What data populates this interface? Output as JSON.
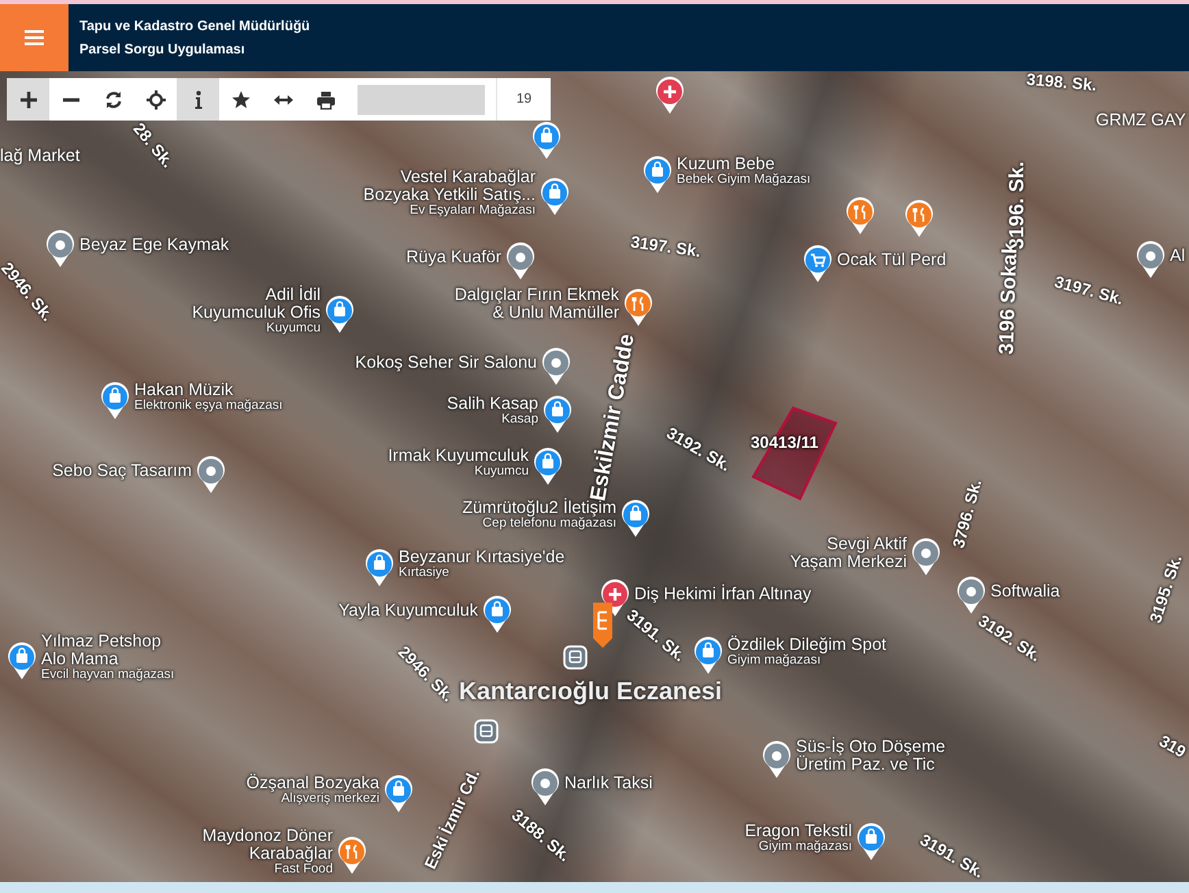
{
  "header": {
    "title": "Tapu ve Kadastro Genel Müdürlüğü",
    "subtitle": "Parsel Sorgu Uygulaması"
  },
  "toolbar": {
    "buttons": [
      {
        "kind": "zoom-in",
        "active": true
      },
      {
        "kind": "zoom-out",
        "active": false
      },
      {
        "kind": "refresh",
        "active": false
      },
      {
        "kind": "locate",
        "active": false
      },
      {
        "kind": "info",
        "active": true
      },
      {
        "kind": "favorite",
        "active": false
      },
      {
        "kind": "measure",
        "active": false
      },
      {
        "kind": "print",
        "active": false
      }
    ],
    "zoom_level": "19"
  },
  "map": {
    "parcel": {
      "label": "30413/11"
    },
    "pois": [
      {
        "kind": "shop"
      },
      {
        "kind": "health"
      },
      {
        "kind": "shop",
        "name_lines": [
          "Kuzum Bebe"
        ],
        "category": "Bebek Giyim Mağazası"
      },
      {
        "kind": "shop",
        "name_lines": [
          "Vestel Karabağlar",
          "Bozyaka Yetkili Satış..."
        ],
        "category": "Ev Eşyaları Mağazası"
      },
      {
        "kind": "place",
        "name_lines": [
          "Beyaz Ege Kaymak"
        ]
      },
      {
        "kind": "place",
        "name_lines": [
          "Rüya Kuaför"
        ]
      },
      {
        "kind": "food"
      },
      {
        "kind": "food"
      },
      {
        "kind": "cart",
        "name_lines": [
          "Ocak Tül Perd"
        ]
      },
      {
        "kind": "place",
        "name_lines": [
          "Al"
        ]
      },
      {
        "kind": "shop",
        "name_lines": [
          "Adil İdil",
          "Kuyumculuk Ofis"
        ],
        "category": "Kuyumcu"
      },
      {
        "kind": "food",
        "name_lines": [
          "Dalgıçlar Fırın Ekmek",
          "& Unlu Mamüller"
        ]
      },
      {
        "kind": "place",
        "name_lines": [
          "Kokoş Seher Sir Salonu"
        ]
      },
      {
        "kind": "shop",
        "name_lines": [
          "Hakan Müzik"
        ],
        "category": "Elektronik eşya mağazası"
      },
      {
        "kind": "shop",
        "name_lines": [
          "Salih Kasap"
        ],
        "category": "Kasap"
      },
      {
        "kind": "place",
        "name_lines": [
          "Sebo Saç Tasarım"
        ]
      },
      {
        "kind": "shop",
        "name_lines": [
          "Irmak Kuyumculuk"
        ],
        "category": "Kuyumcu"
      },
      {
        "kind": "shop",
        "name_lines": [
          "Zümrütoğlu2 İletişim"
        ],
        "category": "Cep telefonu mağazası"
      },
      {
        "kind": "shop",
        "name_lines": [
          "Beyzanur Kırtasiye'de"
        ],
        "category": "Kırtasiye"
      },
      {
        "kind": "place",
        "name_lines": [
          "Sevgi Aktif",
          "Yaşam Merkezi"
        ]
      },
      {
        "kind": "place",
        "name_lines": [
          "Softwalia"
        ]
      },
      {
        "kind": "health",
        "name_lines": [
          "Diş Hekimi İrfan Altınay"
        ]
      },
      {
        "kind": "shop",
        "name_lines": [
          "Yayla Kuyumculuk"
        ]
      },
      {
        "kind": "shop",
        "name_lines": [
          "Yılmaz Petshop",
          "Alo Mama"
        ],
        "category": "Evcil hayvan mağazası"
      },
      {
        "kind": "pharmacy"
      },
      {
        "kind": "transit"
      },
      {
        "kind": "shop",
        "name_lines": [
          "Özdilek Dileğim Spot"
        ],
        "category": "Giyim mağazası"
      },
      {
        "kind": "transit"
      },
      {
        "kind": "place",
        "name_lines": [
          "Süs-İş Oto Döşeme",
          "Üretim Paz. ve Tic"
        ]
      },
      {
        "kind": "place",
        "name_lines": [
          "Narlık Taksi"
        ]
      },
      {
        "kind": "shop",
        "name_lines": [
          "Özşanal Bozyaka"
        ],
        "category": "Alışveriş merkezi"
      },
      {
        "kind": "food",
        "name_lines": [
          "Maydonoz Döner",
          "Karabağlar"
        ],
        "category": "Fast Food"
      },
      {
        "kind": "shop",
        "name_lines": [
          "Eragon Tekstil"
        ],
        "category": "Giyim mağazası"
      }
    ],
    "labels": [
      {
        "kind": "place",
        "text": "lağ Market"
      },
      {
        "kind": "place",
        "text": "GRMZ GAY"
      },
      {
        "kind": "landmark",
        "text": "Kantarcıoğlu Eczanesi"
      }
    ],
    "streets": [
      {
        "name": "28. Sk."
      },
      {
        "name": "2946. Sk."
      },
      {
        "name": "Eskiİzmir Cadde"
      },
      {
        "name": "3197. Sk."
      },
      {
        "name": "3198. Sk."
      },
      {
        "name": "3196. Sk."
      },
      {
        "name": "3196 Sokak"
      },
      {
        "name": "3197. Sk."
      },
      {
        "name": "3192. Sk."
      },
      {
        "name": "3796. Sk."
      },
      {
        "name": "3191. Sk."
      },
      {
        "name": "2946. Sk."
      },
      {
        "name": "Eski İzmir Cd."
      },
      {
        "name": "3188. Sk."
      },
      {
        "name": "3192. Sk."
      },
      {
        "name": "3191. Sk."
      },
      {
        "name": "3195. Sk."
      },
      {
        "name": "319"
      }
    ]
  }
}
